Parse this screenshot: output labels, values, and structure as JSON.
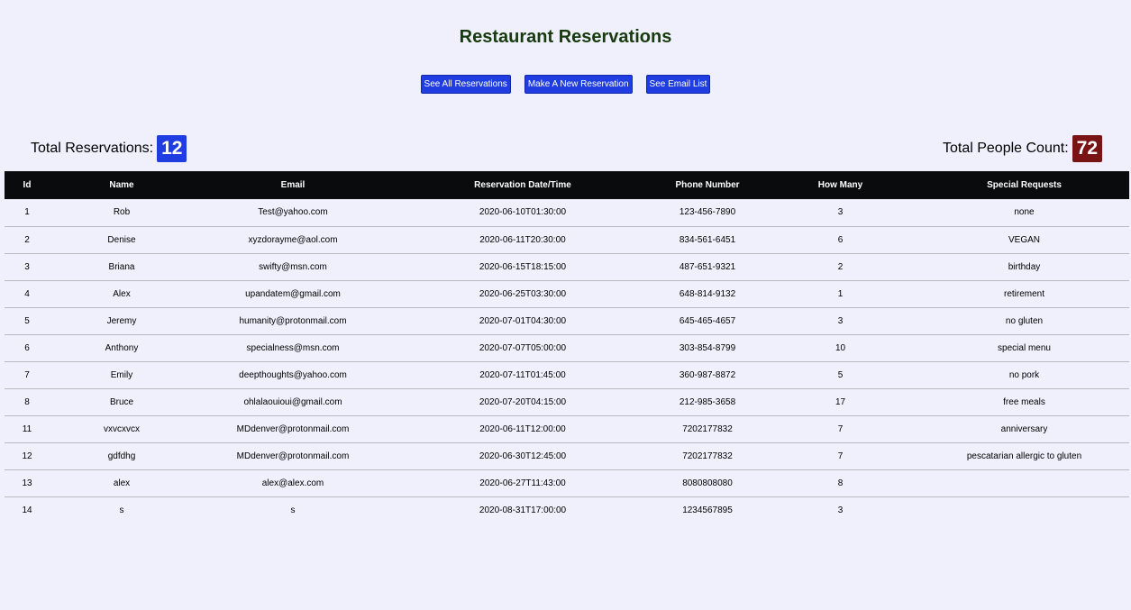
{
  "page": {
    "title": "Restaurant Reservations"
  },
  "nav": {
    "buttons": [
      {
        "label": "See All Reservations"
      },
      {
        "label": "Make A New Reservation"
      },
      {
        "label": "See Email List"
      }
    ]
  },
  "stats": {
    "total_reservations_label": "Total Reservations:",
    "total_reservations_value": "12",
    "total_people_label": "Total People Count:",
    "total_people_value": "72"
  },
  "colors": {
    "title": "#173a0e",
    "button": "#1f3de0",
    "reservations_badge": "#1f3de0",
    "people_badge": "#7a1414",
    "table_header": "#0a0b0d",
    "background": "#eff0fb"
  },
  "table": {
    "columns": [
      "Id",
      "Name",
      "Email",
      "Reservation Date/Time",
      "Phone Number",
      "How Many",
      "Special Requests"
    ],
    "rows": [
      [
        "1",
        "Rob",
        "Test@yahoo.com",
        "2020-06-10T01:30:00",
        "123-456-7890",
        "3",
        "none"
      ],
      [
        "2",
        "Denise",
        "xyzdorayme@aol.com",
        "2020-06-11T20:30:00",
        "834-561-6451",
        "6",
        "VEGAN"
      ],
      [
        "3",
        "Briana",
        "swifty@msn.com",
        "2020-06-15T18:15:00",
        "487-651-9321",
        "2",
        "birthday"
      ],
      [
        "4",
        "Alex",
        "upandatem@gmail.com",
        "2020-06-25T03:30:00",
        "648-814-9132",
        "1",
        "retirement"
      ],
      [
        "5",
        "Jeremy",
        "humanity@protonmail.com",
        "2020-07-01T04:30:00",
        "645-465-4657",
        "3",
        "no gluten"
      ],
      [
        "6",
        "Anthony",
        "specialness@msn.com",
        "2020-07-07T05:00:00",
        "303-854-8799",
        "10",
        "special menu"
      ],
      [
        "7",
        "Emily",
        "deepthoughts@yahoo.com",
        "2020-07-11T01:45:00",
        "360-987-8872",
        "5",
        "no pork"
      ],
      [
        "8",
        "Bruce",
        "ohlalaouioui@gmail.com",
        "2020-07-20T04:15:00",
        "212-985-3658",
        "17",
        "free meals"
      ],
      [
        "11",
        "vxvcxvcx",
        "MDdenver@protonmail.com",
        "2020-06-11T12:00:00",
        "7202177832",
        "7",
        "anniversary"
      ],
      [
        "12",
        "gdfdhg",
        "MDdenver@protonmail.com",
        "2020-06-30T12:45:00",
        "7202177832",
        "7",
        "pescatarian allergic to gluten"
      ],
      [
        "13",
        "alex",
        "alex@alex.com",
        "2020-06-27T11:43:00",
        "8080808080",
        "8",
        ""
      ],
      [
        "14",
        "s",
        "s",
        "2020-08-31T17:00:00",
        "1234567895",
        "3",
        ""
      ]
    ]
  }
}
